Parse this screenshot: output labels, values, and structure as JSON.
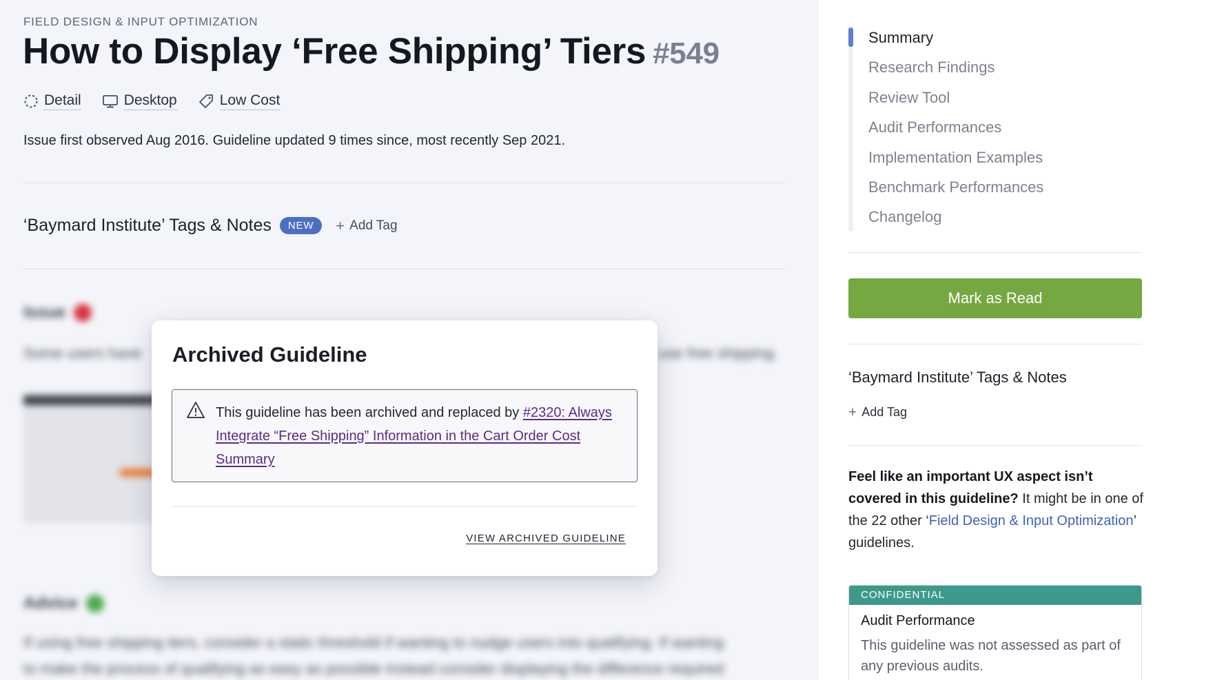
{
  "header": {
    "category": "FIELD DESIGN & INPUT OPTIMIZATION",
    "title": "How to Display ‘Free Shipping’ Tiers",
    "number": "#549"
  },
  "meta": [
    {
      "icon": "detail-icon",
      "label": "Detail"
    },
    {
      "icon": "desktop-icon",
      "label": "Desktop"
    },
    {
      "icon": "tag-icon",
      "label": "Low Cost"
    }
  ],
  "observed": "Issue first observed Aug 2016. Guideline updated 9 times since, most recently Sep 2021.",
  "tags_section": {
    "title": "‘Baymard Institute’ Tags & Notes",
    "badge": "NEW",
    "add_tag": "Add Tag"
  },
  "blurred": {
    "issue_heading": "Issue",
    "issue_text_left": "Some users have",
    "issue_text_right": "use free shipping.",
    "advice_heading": "Advice",
    "advice_line1": "If using free shipping tiers, consider a static threshold if wanting to nudge users into qualifying. If wanting",
    "advice_line2": "to make the process of qualifying as easy as possible instead consider displaying the difference required"
  },
  "modal": {
    "title": "Archived Guideline",
    "notice_prefix": "This guideline has been archived and replaced by ",
    "notice_link": "#2320: Always Integrate “Free Shipping” Information in the Cart Order Cost Summary",
    "view_link": "VIEW ARCHIVED GUIDELINE"
  },
  "sidebar": {
    "toc": [
      {
        "label": "Summary",
        "active": true
      },
      {
        "label": "Research Findings",
        "active": false
      },
      {
        "label": "Review Tool",
        "active": false
      },
      {
        "label": "Audit Performances",
        "active": false
      },
      {
        "label": "Implementation Examples",
        "active": false
      },
      {
        "label": "Benchmark Performances",
        "active": false
      },
      {
        "label": "Changelog",
        "active": false
      }
    ],
    "mark_read": "Mark as Read",
    "tags_title": "‘Baymard Institute’ Tags & Notes",
    "add_tag": "Add Tag",
    "feel_bold": "Feel like an important UX aspect isn’t covered in this guideline?",
    "feel_mid": " It might be in one of the 22 other ‘",
    "feel_link": "Field Design & Input Optimization",
    "feel_end": "’ guidelines.",
    "confidential": {
      "label": "CONFIDENTIAL",
      "title": "Audit Performance",
      "text": "This guideline was not assessed as part of any previous audits."
    }
  },
  "colors": {
    "accent_blue": "#4c6fc4",
    "mark_read_green": "#76a842",
    "confidential_teal": "#3d9a8a",
    "link_purple": "#5b2a86"
  }
}
